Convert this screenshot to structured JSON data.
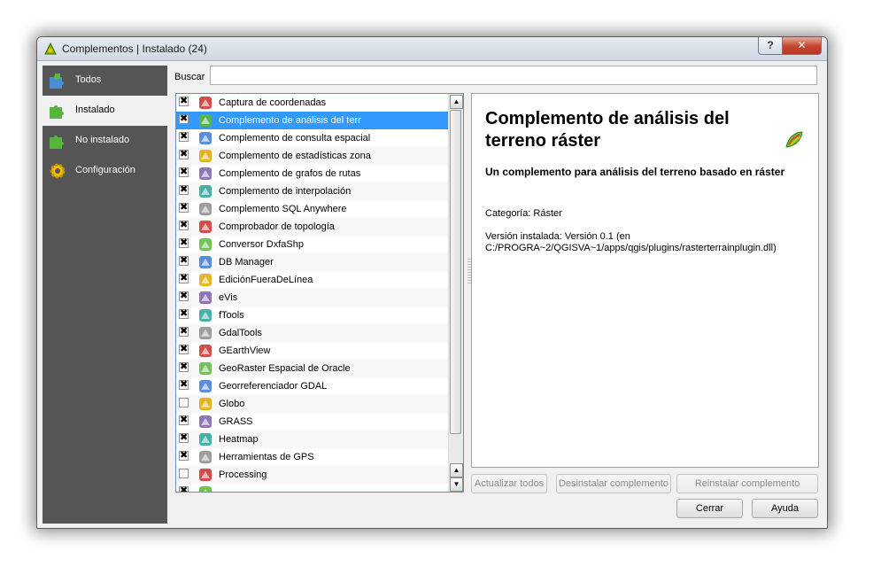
{
  "window": {
    "title": "Complementos | Instalado (24)",
    "help_glyph": "?",
    "close_glyph": "✕"
  },
  "sidebar": {
    "items": [
      {
        "label": "Todos",
        "icon": "puzzle-all-icon"
      },
      {
        "label": "Instalado",
        "icon": "puzzle-installed-icon"
      },
      {
        "label": "No instalado",
        "icon": "puzzle-not-installed-icon"
      },
      {
        "label": "Configuración",
        "icon": "gear-icon"
      }
    ],
    "selected": "Instalado"
  },
  "search": {
    "label": "Buscar",
    "value": ""
  },
  "plugins": [
    {
      "name": "Captura de coordenadas",
      "checked": true,
      "icon": "crosshair-icon"
    },
    {
      "name": "Complemento de análisis del terr",
      "checked": true,
      "icon": "terrain-icon",
      "selected": true
    },
    {
      "name": "Complemento de consulta espacial",
      "checked": true,
      "icon": "spatial-query-icon"
    },
    {
      "name": "Complemento de estadísticas zona",
      "checked": true,
      "icon": "zonal-stats-icon"
    },
    {
      "name": "Complemento de grafos de rutas",
      "checked": true,
      "icon": "road-graph-icon"
    },
    {
      "name": "Complemento de interpolación",
      "checked": true,
      "icon": "interpolation-icon"
    },
    {
      "name": "Complemento SQL Anywhere",
      "checked": true,
      "icon": "sql-anywhere-icon"
    },
    {
      "name": "Comprobador de topología",
      "checked": true,
      "icon": "topology-icon"
    },
    {
      "name": "Conversor DxfaShp",
      "checked": true,
      "icon": "dxf-icon"
    },
    {
      "name": "DB Manager",
      "checked": true,
      "icon": "database-icon"
    },
    {
      "name": "EdiciónFueraDeLínea",
      "checked": true,
      "icon": "offline-edit-icon"
    },
    {
      "name": "eVis",
      "checked": true,
      "icon": "evis-icon"
    },
    {
      "name": "fTools",
      "checked": true,
      "icon": "ftools-icon"
    },
    {
      "name": "GdalTools",
      "checked": true,
      "icon": "gdal-icon"
    },
    {
      "name": "GEarthView",
      "checked": true,
      "icon": "gearth-icon"
    },
    {
      "name": "GeoRaster Espacial de Oracle",
      "checked": true,
      "icon": "oracle-icon"
    },
    {
      "name": "Georreferenciador GDAL",
      "checked": true,
      "icon": "georeferencer-icon"
    },
    {
      "name": "Globo",
      "checked": false,
      "icon": "globe-icon"
    },
    {
      "name": "GRASS",
      "checked": true,
      "icon": "grass-icon"
    },
    {
      "name": "Heatmap",
      "checked": true,
      "icon": "heatmap-icon"
    },
    {
      "name": "Herramientas de GPS",
      "checked": true,
      "icon": "gps-icon"
    },
    {
      "name": "Processing",
      "checked": false,
      "icon": "processing-gear-icon"
    },
    {
      "name": "",
      "checked": true,
      "icon": "partial-row-icon"
    }
  ],
  "details": {
    "title": "Complemento de análisis del terreno ráster",
    "subtitle": "Un complemento para análisis del terreno basado en ráster",
    "category": "Categoría: Ráster",
    "version": "Versión instalada: Versión 0.1 (en C:/PROGRA~2/QGISVA~1/apps/qgis/plugins/rasterterrainplugin.dll)"
  },
  "buttons": {
    "update_all": "Actualizar todos",
    "uninstall": "Desinstalar complemento",
    "reinstall": "Reinstalar complemento",
    "close": "Cerrar",
    "help": "Ayuda"
  },
  "colors": {
    "sidebar_bg": "#555555",
    "selection": "#3399ff"
  }
}
